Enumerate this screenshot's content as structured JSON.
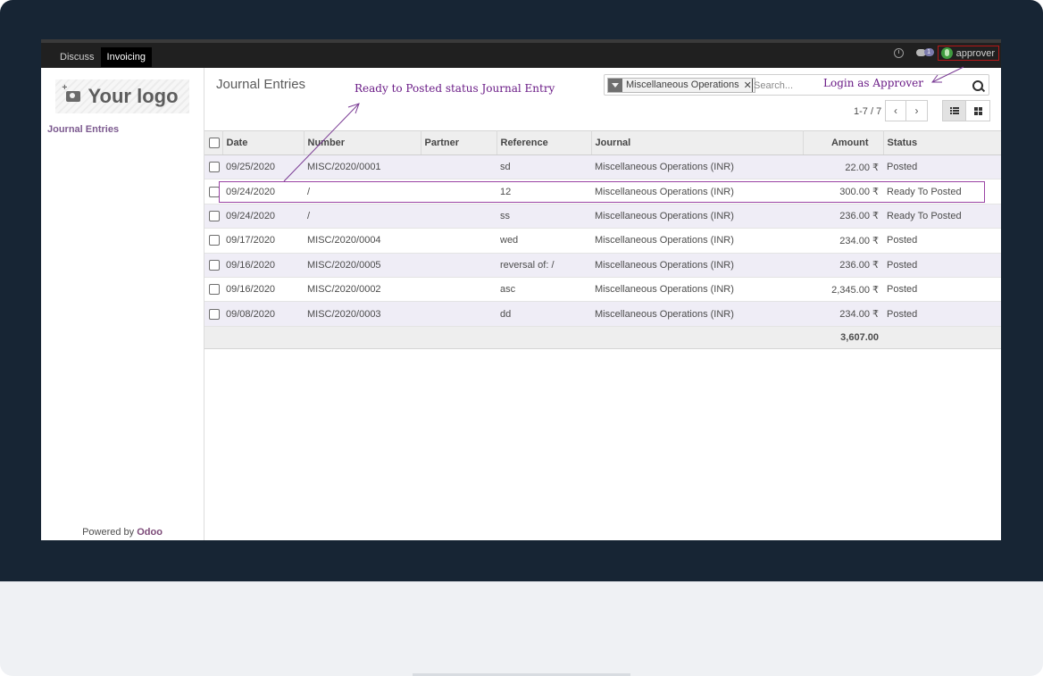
{
  "navbar": {
    "menu": [
      "Discuss",
      "Invoicing"
    ],
    "active_menu": "Invoicing",
    "chat_badge": "1",
    "user": "approver"
  },
  "sidebar": {
    "logo_text": "Your logo",
    "menu_item": "Journal Entries",
    "powered_by": "Powered by",
    "brand": "Odoo"
  },
  "control_panel": {
    "title": "Journal Entries",
    "filter_facet": "Miscellaneous Operations",
    "search_placeholder": "Search...",
    "pager": "1-7 / 7"
  },
  "table": {
    "columns": [
      "Date",
      "Number",
      "Partner",
      "Reference",
      "Journal",
      "Amount",
      "Status"
    ],
    "rows": [
      {
        "date": "09/25/2020",
        "number": "MISC/2020/0001",
        "partner": "",
        "reference": "sd",
        "journal": "Miscellaneous Operations (INR)",
        "amount": "22.00 ₹",
        "status": "Posted"
      },
      {
        "date": "09/24/2020",
        "number": "/",
        "partner": "",
        "reference": "12",
        "journal": "Miscellaneous Operations (INR)",
        "amount": "300.00 ₹",
        "status": "Ready To Posted"
      },
      {
        "date": "09/24/2020",
        "number": "/",
        "partner": "",
        "reference": "ss",
        "journal": "Miscellaneous Operations (INR)",
        "amount": "236.00 ₹",
        "status": "Ready To Posted"
      },
      {
        "date": "09/17/2020",
        "number": "MISC/2020/0004",
        "partner": "",
        "reference": "wed",
        "journal": "Miscellaneous Operations (INR)",
        "amount": "234.00 ₹",
        "status": "Posted"
      },
      {
        "date": "09/16/2020",
        "number": "MISC/2020/0005",
        "partner": "",
        "reference": "reversal of: /",
        "journal": "Miscellaneous Operations (INR)",
        "amount": "236.00 ₹",
        "status": "Posted"
      },
      {
        "date": "09/16/2020",
        "number": "MISC/2020/0002",
        "partner": "",
        "reference": "asc",
        "journal": "Miscellaneous Operations (INR)",
        "amount": "2,345.00 ₹",
        "status": "Posted"
      },
      {
        "date": "09/08/2020",
        "number": "MISC/2020/0003",
        "partner": "",
        "reference": "dd",
        "journal": "Miscellaneous Operations (INR)",
        "amount": "234.00 ₹",
        "status": "Posted"
      }
    ],
    "total_amount": "3,607.00"
  },
  "annotations": {
    "ready_note": "Ready to Posted status Journal Entry",
    "login_note": "Login as Approver",
    "color": "#6a1b86"
  }
}
